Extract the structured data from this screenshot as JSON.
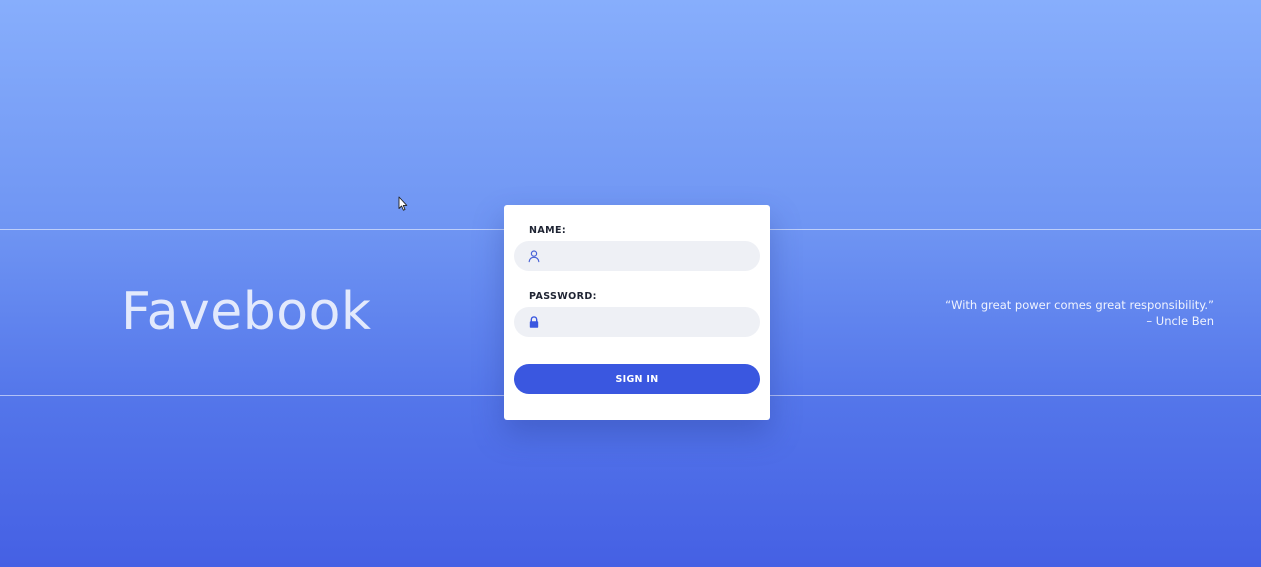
{
  "brand": {
    "title": "Favebook"
  },
  "quote": {
    "text": "“With great power comes great responsibility.”",
    "author": "– Uncle Ben"
  },
  "login_form": {
    "name_label": "NAME:",
    "name_value": "",
    "name_icon": "user-icon",
    "password_label": "PASSWORD:",
    "password_value": "",
    "password_icon": "lock-icon",
    "submit_label": "SIGN IN"
  },
  "colors": {
    "background_top": "#87aefc",
    "background_bottom": "#4560e4",
    "accent": "#3a57e0",
    "field_bg": "#eef0f5",
    "card_bg": "#ffffff"
  }
}
